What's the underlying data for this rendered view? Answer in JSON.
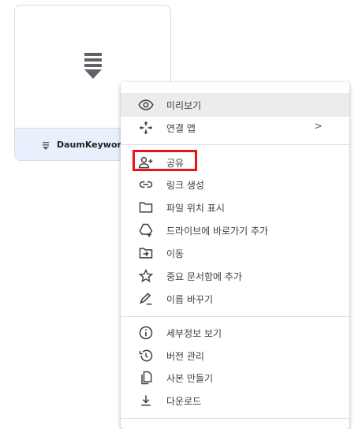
{
  "file": {
    "name": "DaumKeywordQ",
    "thumb_icon": "download-file-icon"
  },
  "menu": {
    "items": [
      {
        "label": "미리보기",
        "icon": "eye-icon"
      },
      {
        "label": "연결 앱",
        "icon": "open-with-icon",
        "arrow": ">"
      },
      {
        "label": "공유",
        "icon": "person-add-icon"
      },
      {
        "label": "링크 생성",
        "icon": "link-icon"
      },
      {
        "label": "파일 위치 표시",
        "icon": "folder-icon"
      },
      {
        "label": "드라이브에 바로가기 추가",
        "icon": "add-to-drive-icon"
      },
      {
        "label": "이동",
        "icon": "move-icon"
      },
      {
        "label": "중요 문서함에 추가",
        "icon": "star-icon"
      },
      {
        "label": "이름 바꾸기",
        "icon": "pencil-icon"
      },
      {
        "label": "세부정보 보기",
        "icon": "info-icon"
      },
      {
        "label": "버전 관리",
        "icon": "history-icon"
      },
      {
        "label": "사본 만들기",
        "icon": "copy-icon"
      },
      {
        "label": "다운로드",
        "icon": "download-icon"
      }
    ]
  },
  "colors": {
    "highlight_border": "#e8141c",
    "hover_bg": "#ececec",
    "selected_footer_bg": "#e8f0fe"
  }
}
